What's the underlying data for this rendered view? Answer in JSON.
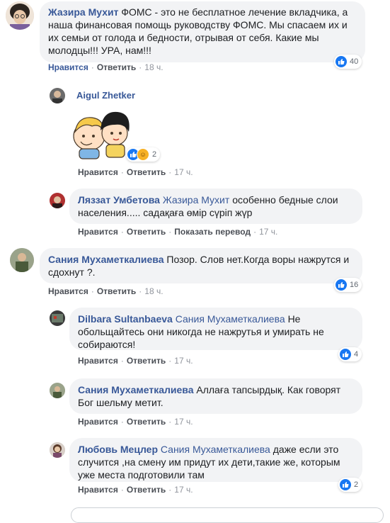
{
  "actions": {
    "like": "Нравится",
    "reply": "Ответить",
    "translate": "Показать перевод"
  },
  "comments": [
    {
      "author": "Жазира Мухит",
      "text": "ФОМС - это не бесплатное лечение вкладчика, а наша финансовая помощь руководству ФОМС. Мы спасаем их и их семьи от голода и бедности, отрывая от себя. Какие мы молодцы!!! УРА, нам!!!",
      "time": "18 ч.",
      "reactions": "40"
    },
    {
      "author": "Aigul Zhetker",
      "time": "17 ч.",
      "reactions": "2",
      "sticker": "sticker-two-kids-hug"
    },
    {
      "author": "Ляззат Умбетова",
      "mention": "Жазира Мухит",
      "text": "особенно бедные слои населения..... садақаға өмір сүріп жүр",
      "time": "17 ч."
    },
    {
      "author": "Сания Мухаметкалиева",
      "text": "Позор. Слов нет.Когда воры нажрутся и сдохнут ?.",
      "time": "18 ч.",
      "reactions": "16"
    },
    {
      "author": "Dilbara Sultanbaeva",
      "mention": "Сания Мухаметкалиева",
      "text": "Не обольщайтесь они никогда не нажрутья и умирать не собираются!",
      "time": "17 ч.",
      "reactions": "4"
    },
    {
      "author": "Сания Мухаметкалиева",
      "text": "Аллаға тапсырдық. Как говорят Бог шельму метит.",
      "time": "17 ч."
    },
    {
      "author": "Любовь Мецлер",
      "mention": "Сания Мухаметкалиева",
      "text": "даже если это случится ,на смену им придут их дети,такие же, которым уже места подготовили там",
      "time": "17 ч.",
      "reactions": "2"
    }
  ],
  "colors": {
    "link": "#385898",
    "like_blue": "#1877f2",
    "bubble_bg": "#f2f3f5"
  }
}
